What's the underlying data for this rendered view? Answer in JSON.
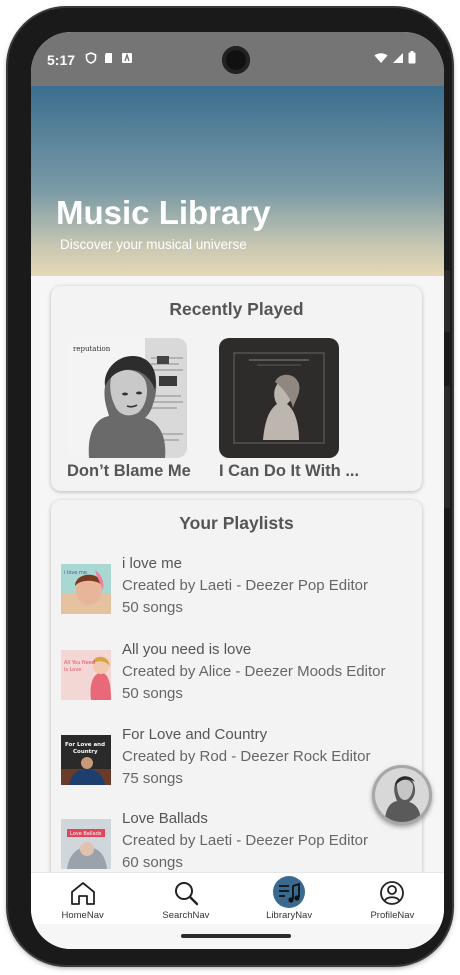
{
  "status_bar": {
    "time": "5:17"
  },
  "header": {
    "title": "Music Library",
    "subtitle": "Discover your musical universe"
  },
  "recently_played": {
    "title": "Recently Played",
    "items": [
      {
        "name": "Don’t Blame Me",
        "cover_icon": "album-cover-reputation"
      },
      {
        "name": "I Can Do It With ...",
        "cover_icon": "album-cover-tortured-poets"
      }
    ]
  },
  "playlists": {
    "title": "Your Playlists",
    "items": [
      {
        "name": "i love me",
        "creator": "Created by Laeti - Deezer Pop Editor",
        "songs": "50 songs"
      },
      {
        "name": "All you need is love",
        "creator": "Created by Alice - Deezer Moods Editor",
        "songs": "50 songs"
      },
      {
        "name": "For Love and Country",
        "creator": "Created by Rod - Deezer Rock Editor",
        "songs": "75 songs"
      },
      {
        "name": "Love Ballads",
        "creator": "Created by Laeti - Deezer Pop Editor",
        "songs": "60 songs"
      }
    ]
  },
  "thumbnails": {
    "t1_text": "i love me",
    "t2_text": "All You Need is Love",
    "t3_text": "For Love and Country",
    "t4_text": "Love Ballads"
  },
  "nav": {
    "items": [
      {
        "label": "HomeNav",
        "icon": "home-icon"
      },
      {
        "label": "SearchNav",
        "icon": "search-icon"
      },
      {
        "label": "LibraryNav",
        "icon": "library-icon"
      },
      {
        "label": "ProfileNav",
        "icon": "profile-icon"
      }
    ],
    "active_index": 2
  },
  "colors": {
    "accent": "#3a6a8f",
    "status_bar": "#757575",
    "card_bg": "#f3f3f3"
  }
}
